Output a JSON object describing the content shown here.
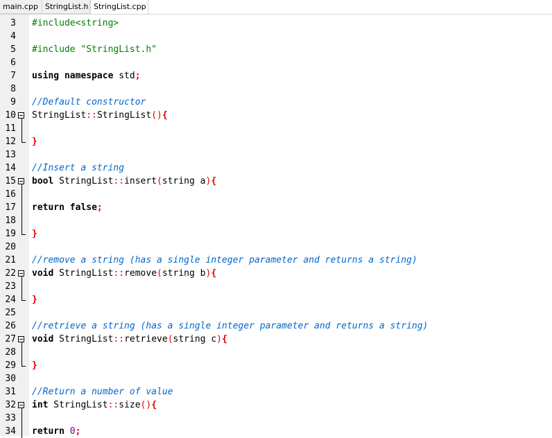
{
  "tabs": [
    {
      "label": "main.cpp",
      "active": false
    },
    {
      "label": "StringList.h",
      "active": false
    },
    {
      "label": "StringList.cpp",
      "active": true
    }
  ],
  "editor": {
    "lines": [
      {
        "n": "3",
        "tokens": [
          {
            "t": "#include<string>",
            "c": "pp"
          }
        ]
      },
      {
        "n": "4",
        "tokens": []
      },
      {
        "n": "5",
        "tokens": [
          {
            "t": "#include \"StringList.h\"",
            "c": "pp"
          }
        ]
      },
      {
        "n": "6",
        "tokens": []
      },
      {
        "n": "7",
        "tokens": [
          {
            "t": "using namespace",
            "c": "kw"
          },
          {
            "t": " std",
            "c": ""
          },
          {
            "t": ";",
            "c": "opb"
          }
        ]
      },
      {
        "n": "8",
        "tokens": []
      },
      {
        "n": "9",
        "tokens": [
          {
            "t": "//Default constructor",
            "c": "cm"
          }
        ]
      },
      {
        "n": "10",
        "fold": "start",
        "tokens": [
          {
            "t": "StringList",
            "c": ""
          },
          {
            "t": "::",
            "c": "op"
          },
          {
            "t": "StringList",
            "c": ""
          },
          {
            "t": "()",
            "c": "op"
          },
          {
            "t": "{",
            "c": "opb"
          }
        ]
      },
      {
        "n": "11",
        "fold": "mid",
        "tokens": []
      },
      {
        "n": "12",
        "fold": "end",
        "tokens": [
          {
            "t": "}",
            "c": "opb"
          }
        ]
      },
      {
        "n": "13",
        "tokens": []
      },
      {
        "n": "14",
        "tokens": [
          {
            "t": "//Insert a string",
            "c": "cm"
          }
        ]
      },
      {
        "n": "15",
        "fold": "start",
        "tokens": [
          {
            "t": "bool",
            "c": "kw"
          },
          {
            "t": " StringList",
            "c": ""
          },
          {
            "t": "::",
            "c": "op"
          },
          {
            "t": "insert",
            "c": ""
          },
          {
            "t": "(",
            "c": "op"
          },
          {
            "t": "string a",
            "c": ""
          },
          {
            "t": ")",
            "c": "op"
          },
          {
            "t": "{",
            "c": "opb"
          }
        ]
      },
      {
        "n": "16",
        "fold": "mid",
        "tokens": []
      },
      {
        "n": "17",
        "fold": "mid",
        "tokens": [
          {
            "t": "return false",
            "c": "kw"
          },
          {
            "t": ";",
            "c": "opb"
          }
        ]
      },
      {
        "n": "18",
        "fold": "mid",
        "tokens": []
      },
      {
        "n": "19",
        "fold": "end",
        "tokens": [
          {
            "t": "}",
            "c": "opb"
          }
        ]
      },
      {
        "n": "20",
        "tokens": []
      },
      {
        "n": "21",
        "tokens": [
          {
            "t": "//remove a string (has a single integer parameter and returns a string)",
            "c": "cm"
          }
        ]
      },
      {
        "n": "22",
        "fold": "start",
        "tokens": [
          {
            "t": "void",
            "c": "kw"
          },
          {
            "t": " StringList",
            "c": ""
          },
          {
            "t": "::",
            "c": "op"
          },
          {
            "t": "remove",
            "c": ""
          },
          {
            "t": "(",
            "c": "op"
          },
          {
            "t": "string b",
            "c": ""
          },
          {
            "t": ")",
            "c": "op"
          },
          {
            "t": "{",
            "c": "opb"
          }
        ]
      },
      {
        "n": "23",
        "fold": "mid",
        "tokens": []
      },
      {
        "n": "24",
        "fold": "end",
        "tokens": [
          {
            "t": "}",
            "c": "opb"
          }
        ]
      },
      {
        "n": "25",
        "tokens": []
      },
      {
        "n": "26",
        "tokens": [
          {
            "t": "//retrieve a string (has a single integer parameter and returns a string)",
            "c": "cm"
          }
        ]
      },
      {
        "n": "27",
        "fold": "start",
        "tokens": [
          {
            "t": "void",
            "c": "kw"
          },
          {
            "t": " StringList",
            "c": ""
          },
          {
            "t": "::",
            "c": "op"
          },
          {
            "t": "retrieve",
            "c": ""
          },
          {
            "t": "(",
            "c": "op"
          },
          {
            "t": "string c",
            "c": ""
          },
          {
            "t": ")",
            "c": "op"
          },
          {
            "t": "{",
            "c": "opb"
          }
        ]
      },
      {
        "n": "28",
        "fold": "mid",
        "tokens": []
      },
      {
        "n": "29",
        "fold": "end",
        "tokens": [
          {
            "t": "}",
            "c": "opb"
          }
        ]
      },
      {
        "n": "30",
        "tokens": []
      },
      {
        "n": "31",
        "tokens": [
          {
            "t": "//Return a number of value",
            "c": "cm"
          }
        ]
      },
      {
        "n": "32",
        "fold": "start",
        "tokens": [
          {
            "t": "int",
            "c": "kw"
          },
          {
            "t": " StringList",
            "c": ""
          },
          {
            "t": "::",
            "c": "op"
          },
          {
            "t": "size",
            "c": ""
          },
          {
            "t": "()",
            "c": "op"
          },
          {
            "t": "{",
            "c": "opb"
          }
        ]
      },
      {
        "n": "33",
        "fold": "mid",
        "tokens": []
      },
      {
        "n": "34",
        "fold": "mid",
        "tokens": [
          {
            "t": "return",
            "c": "kw"
          },
          {
            "t": " ",
            "c": ""
          },
          {
            "t": "0",
            "c": "num"
          },
          {
            "t": ";",
            "c": "opb"
          }
        ]
      }
    ]
  }
}
